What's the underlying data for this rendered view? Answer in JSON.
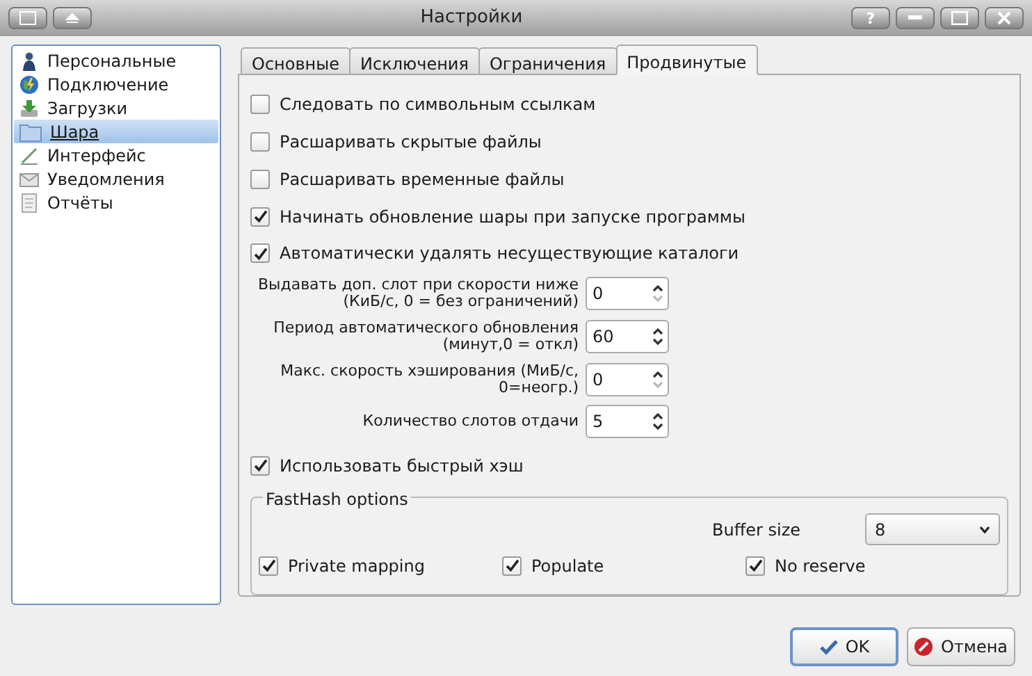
{
  "window": {
    "title": "Настройки",
    "help_button": "?"
  },
  "sidebar": {
    "items": [
      {
        "label": "Персональные",
        "selected": false
      },
      {
        "label": "Подключение",
        "selected": false
      },
      {
        "label": "Загрузки",
        "selected": false
      },
      {
        "label": "Шара",
        "selected": true
      },
      {
        "label": "Интерфейс",
        "selected": false
      },
      {
        "label": "Уведомления",
        "selected": false
      },
      {
        "label": "Отчёты",
        "selected": false
      }
    ]
  },
  "tabs": [
    {
      "label": "Основные",
      "selected": false
    },
    {
      "label": "Исключения",
      "selected": false
    },
    {
      "label": "Ограничения",
      "selected": false
    },
    {
      "label": "Продвинутые",
      "selected": true
    }
  ],
  "options": [
    {
      "label": "Следовать по символьным ссылкам",
      "checked": false
    },
    {
      "label": "Расшаривать скрытые файлы",
      "checked": false
    },
    {
      "label": "Расшаривать временные файлы",
      "checked": false
    },
    {
      "label": "Начинать обновление шары при запуске программы",
      "checked": true
    },
    {
      "label": "Автоматически удалять несуществующие каталоги",
      "checked": true
    }
  ],
  "spin_fields": [
    {
      "label": "Выдавать доп. слот при скорости ниже (КиБ/с, 0 = без ограничений)",
      "value": "0",
      "at_minimum": true
    },
    {
      "label": "Период автоматического обновления (минут,0 = откл)",
      "value": "60",
      "at_minimum": false
    },
    {
      "label": "Макс. скорость хэширования (МиБ/с, 0=неогр.)",
      "value": "0",
      "at_minimum": true
    },
    {
      "label": "Количество слотов отдачи",
      "value": "5",
      "at_minimum": false
    }
  ],
  "fast_hash": {
    "label": "Использовать быстрый хэш",
    "checked": true
  },
  "fasthash_options": {
    "title": "FastHash options",
    "buffer_size": {
      "label": "Buffer size",
      "value": "8"
    },
    "checks": [
      {
        "label": "Private mapping",
        "checked": true
      },
      {
        "label": "Populate",
        "checked": true
      },
      {
        "label": "No reserve",
        "checked": true
      }
    ]
  },
  "buttons": [
    {
      "label": "OK",
      "kind": "ok"
    },
    {
      "label": "Отмена",
      "kind": "cancel"
    }
  ]
}
